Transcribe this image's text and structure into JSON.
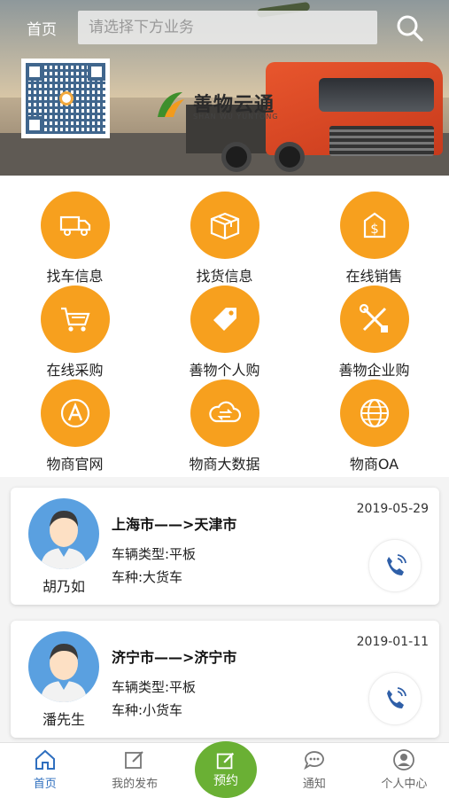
{
  "header": {
    "home_label": "首页",
    "search_placeholder": "请选择下方业务"
  },
  "banner": {
    "brand_cn": "善物云通",
    "brand_en": "SHAN WU YUNTONG"
  },
  "services": [
    {
      "label": "找车信息",
      "icon": "truck-icon"
    },
    {
      "label": "找货信息",
      "icon": "package-icon"
    },
    {
      "label": "在线销售",
      "icon": "money-bag-icon"
    },
    {
      "label": "在线采购",
      "icon": "cart-icon"
    },
    {
      "label": "善物个人购",
      "icon": "tag-icon"
    },
    {
      "label": "善物企业购",
      "icon": "tools-icon"
    },
    {
      "label": "物商官网",
      "icon": "letter-a-icon"
    },
    {
      "label": "物商大数据",
      "icon": "cloud-sync-icon"
    },
    {
      "label": "物商OA",
      "icon": "globe-icon"
    }
  ],
  "listings": [
    {
      "name": "胡乃如",
      "route": "上海市——>天津市",
      "date": "2019-05-29",
      "vehicle_type": "车辆类型:平板",
      "vehicle_kind": "车种:大货车"
    },
    {
      "name": "潘先生",
      "route": "济宁市——>济宁市",
      "date": "2019-01-11",
      "vehicle_type": "车辆类型:平板",
      "vehicle_kind": "车种:小货车"
    }
  ],
  "nav": {
    "home": "首页",
    "my_posts": "我的发布",
    "booking": "预约",
    "notifications": "通知",
    "profile": "个人中心"
  },
  "colors": {
    "accent_orange": "#f7a01e",
    "nav_active": "#2f6fbf",
    "booking_green": "#6ab034",
    "phone_blue": "#2f5fa8"
  }
}
